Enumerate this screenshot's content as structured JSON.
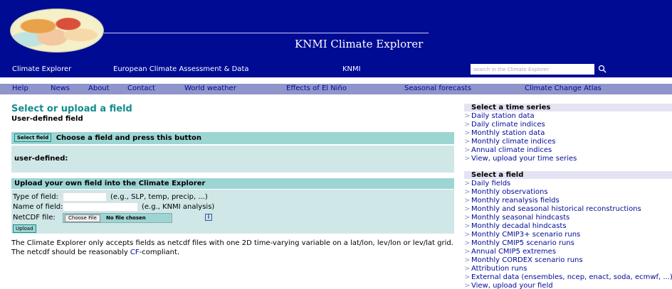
{
  "header": {
    "site_title": "KNMI Climate Explorer",
    "search_placeholder": "search in the Climate Explorer",
    "nav_primary": [
      "Climate Explorer",
      "European Climate Assessment & Data",
      "KNMI"
    ],
    "nav_secondary": [
      "Help",
      "News",
      "About",
      "Contact",
      "World weather",
      "Effects of El Niño",
      "Seasonal forecasts",
      "Climate Change Atlas"
    ],
    "colors": {
      "banner": "#000b94",
      "subnav": "#8f95ca",
      "accent": "#138c8f"
    }
  },
  "main": {
    "title": "Select or upload a field",
    "subtitle": "User-defined field",
    "select_box": {
      "button_label": "Select field",
      "heading": "Choose a field and press this button",
      "label": "user-defined:"
    },
    "upload_box": {
      "heading": "Upload your own field into the Climate Explorer",
      "type_label": "Type of field:",
      "type_value": "",
      "type_hint": "(e.g., SLP, temp, precip, ...)",
      "name_label": "Name of field:",
      "name_value": "",
      "name_hint": "(e.g., KNMI analysis)",
      "file_label": "NetCDF file:",
      "file_button": "Choose File",
      "file_status": "No file chosen",
      "info_icon": "i",
      "upload_button": "Upload"
    },
    "note_before": "The Climate Explorer only accepts fields as netcdf files with one 2D time-varying variable on a lat/lon, lev/lon or lev/lat grid. The netcdf should be reasonably ",
    "note_link": "CF",
    "note_after": "-compliant."
  },
  "sidebar": {
    "time_series_heading": "Select a time series",
    "time_series_items": [
      "Daily station data",
      "Daily climate indices",
      "Monthly station data",
      "Monthly climate indices",
      "Annual climate indices",
      "View, upload your time series"
    ],
    "field_heading": "Select a field",
    "field_items": [
      "Daily fields",
      "Monthly observations",
      "Monthly reanalysis fields",
      "Monthly and seasonal historical reconstructions",
      "Monthly seasonal hindcasts",
      "Monthly decadal hindcasts",
      "Monthly CMIP3+ scenario runs",
      "Monthly CMIP5 scenario runs",
      "Annual CMIP5 extremes",
      "Monthly CORDEX scenario runs",
      "Attribution runs",
      "External data (ensembles, ncep, enact, soda, ecmwf, ...)",
      "View, upload your field"
    ]
  }
}
